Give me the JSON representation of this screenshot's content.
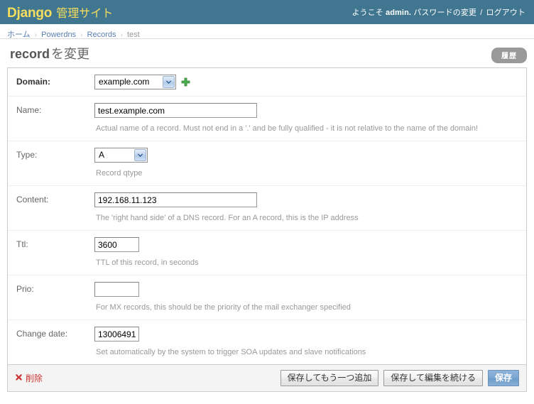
{
  "header": {
    "site_name_brand": "Django",
    "site_name_rest": "管理サイト",
    "welcome_prefix": "ようこそ",
    "username": "admin.",
    "change_password_label": "パスワードの変更",
    "separator": "/",
    "logout_label": "ログアウト",
    "bg_color": "#417690",
    "brand_color": "#f5dd5d"
  },
  "breadcrumbs": {
    "items": [
      {
        "label": "ホーム",
        "is_link": true
      },
      {
        "label": "Powerdns",
        "is_link": true
      },
      {
        "label": "Records",
        "is_link": true
      },
      {
        "label": "test",
        "is_link": false
      }
    ],
    "separator": "›"
  },
  "page": {
    "title_main": "record",
    "title_suffix": "を変更",
    "history_button_label": "履歴"
  },
  "form": {
    "rows": [
      {
        "name": "domain",
        "label": "Domain:",
        "required": true,
        "widget": "select",
        "value": "example.com",
        "help": "",
        "has_add_another": true
      },
      {
        "name": "name",
        "label": "Name:",
        "required": false,
        "widget": "text",
        "value": "test.example.com",
        "placeholder": "",
        "help": "Actual name of a record. Must not end in a '.' and be fully qualified - it is not relative to the name of the domain!"
      },
      {
        "name": "type",
        "label": "Type:",
        "required": false,
        "widget": "select",
        "value": "A",
        "help": "Record qtype"
      },
      {
        "name": "content",
        "label": "Content:",
        "required": false,
        "widget": "text",
        "value": "192.168.11.123",
        "placeholder": "",
        "help": "The 'right hand side' of a DNS record. For an A record, this is the IP address"
      },
      {
        "name": "ttl",
        "label": "Ttl:",
        "required": false,
        "widget": "text",
        "value": "3600",
        "placeholder": "",
        "help": "TTL of this record, in seconds"
      },
      {
        "name": "prio",
        "label": "Prio:",
        "required": false,
        "widget": "text",
        "value": "",
        "placeholder": "",
        "help": "For MX records, this should be the priority of the mail exchanger specified"
      },
      {
        "name": "change_date",
        "label": "Change date:",
        "required": false,
        "widget": "text",
        "value": "13006491",
        "placeholder": "",
        "help": "Set automatically by the system to trigger SOA updates and slave notifications"
      }
    ]
  },
  "submit_row": {
    "delete_label": "削除",
    "delete_color": "#cc3333",
    "save_add_another_label": "保存してもう一つ追加",
    "save_continue_label": "保存して編集を続ける",
    "save_label": "保存"
  }
}
